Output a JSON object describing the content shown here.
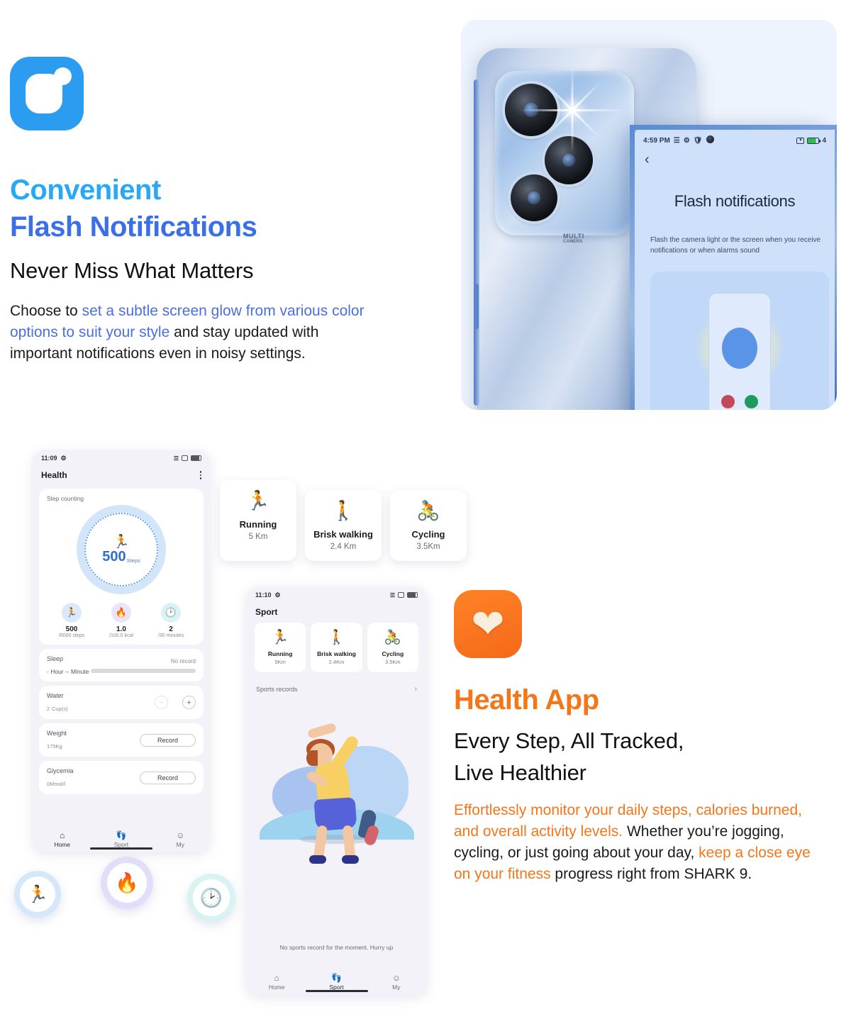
{
  "flash_section": {
    "app_icon": "flash-notification-app-icon",
    "title_line1": "Convenient",
    "title_line2": "Flash Notifications",
    "subtitle": "Never Miss What Matters",
    "body": {
      "part1": "Choose to ",
      "highlight": "set a subtle screen glow from various color options to suit your style",
      "part2": " and stay updated with important notifications even in noisy settings."
    },
    "colors": {
      "title1": "#29a8f5",
      "title2": "#3b6fe8",
      "highlight": "#4a6fe0"
    },
    "phone": {
      "camera_label": "MULTI",
      "camera_sub": "CAMERA",
      "status_time": "4:59 PM",
      "battery_level": "4",
      "back_label": "‹",
      "screen_title": "Flash notifications",
      "screen_desc": "Flash the camera light or the screen when you receive notifications or when alarms sound"
    }
  },
  "health_section": {
    "app_icon": "health-app-icon",
    "title": "Health App",
    "subtitle_line1": "Every Step, All Tracked,",
    "subtitle_line2": "Live Healthier",
    "body": {
      "hl1": "Effortlessly monitor your daily steps, calories burned, and overall activity levels.",
      "mid": " Whether you’re jogging, cycling, or just going about your day, ",
      "hl2": "keep a close eye on your fitness",
      "end": " progress right from SHARK 9."
    },
    "colors": {
      "accent": "#f4761a"
    },
    "health_phone": {
      "status_time": "11:09",
      "app_title": "Health",
      "step_card": {
        "label": "Step counting",
        "value": "500",
        "unit": "Steps",
        "stats": [
          {
            "icon": "runner-icon",
            "value": "500",
            "unit": "/6000 steps"
          },
          {
            "icon": "flame-icon",
            "value": "1.0",
            "unit": "/100.0 kcal"
          },
          {
            "icon": "clock-icon",
            "value": "2",
            "unit": "/30 minutes"
          }
        ]
      },
      "sleep_card": {
        "title": "Sleep",
        "value": "- Hour -- Minute",
        "status": "No record"
      },
      "water_card": {
        "title": "Water",
        "value": "2",
        "unit": "Cup(s)",
        "minus": "−",
        "plus": "+"
      },
      "weight_card": {
        "title": "Weight",
        "value": "175",
        "unit": "Kg",
        "button": "Record"
      },
      "glycemia_card": {
        "title": "Glycemia",
        "value": "0",
        "unit": "Mmol/l",
        "button": "Record"
      },
      "nav": [
        {
          "icon": "home-icon",
          "label": "Home"
        },
        {
          "icon": "shoe-icon",
          "label": "Sport"
        },
        {
          "icon": "person-icon",
          "label": "My"
        }
      ]
    },
    "activity_cards": [
      {
        "icon": "runner-icon",
        "name": "Running",
        "distance": "5 Km"
      },
      {
        "icon": "walker-icon",
        "name": "Brisk walking",
        "distance": "2.4 Km"
      },
      {
        "icon": "cyclist-icon",
        "name": "Cycling",
        "distance": "3.5Km"
      }
    ],
    "sport_phone": {
      "status_time": "11:10",
      "app_title": "Sport",
      "cards": [
        {
          "icon": "runner-icon",
          "name": "Running",
          "distance": "5Km"
        },
        {
          "icon": "walker-icon",
          "name": "Brisk walking",
          "distance": "2.4Km"
        },
        {
          "icon": "cyclist-icon",
          "name": "Cycling",
          "distance": "3.5Km"
        }
      ],
      "records_label": "Sports records",
      "records_chevron": "›",
      "empty_text": "No sports record for the moment. Hurry up",
      "nav": [
        {
          "icon": "home-icon",
          "label": "Home"
        },
        {
          "icon": "shoe-icon",
          "label": "Sport"
        },
        {
          "icon": "person-icon",
          "label": "My"
        }
      ]
    },
    "floating_badges": [
      {
        "icon": "runner-icon",
        "color": "#d5e7fa"
      },
      {
        "icon": "flame-icon",
        "color": "#e4ddfa"
      },
      {
        "icon": "clock-icon",
        "color": "#d8f3f2"
      }
    ]
  }
}
